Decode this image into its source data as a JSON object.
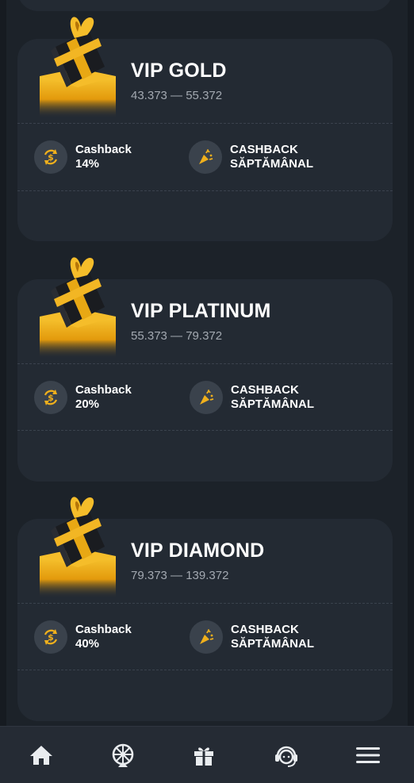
{
  "tiers": [
    {
      "title": "VIP GOLD",
      "range": "43.373 — 55.372",
      "cashback_label": "Cashback",
      "cashback_value": "14%",
      "weekly_line1": "CASHBACK",
      "weekly_line2": "SĂPTĂMÂNAL"
    },
    {
      "title": "VIP PLATINUM",
      "range": "55.373 — 79.372",
      "cashback_label": "Cashback",
      "cashback_value": "20%",
      "weekly_line1": "CASHBACK",
      "weekly_line2": "SĂPTĂMÂNAL"
    },
    {
      "title": "VIP DIAMOND",
      "range": "79.373 — 139.372",
      "cashback_label": "Cashback",
      "cashback_value": "40%",
      "weekly_line1": "CASHBACK",
      "weekly_line2": "SĂPTĂMÂNAL"
    }
  ],
  "icons": {
    "gift_image": "gift-box-icon",
    "cashback": "cashback-coin-icon",
    "weekly": "party-popper-icon"
  },
  "nav": {
    "items": [
      "home-icon",
      "wheel-of-fortune-icon",
      "gift-icon",
      "support-headset-icon",
      "menu-icon"
    ]
  },
  "colors": {
    "background": "#1c2229",
    "card": "#232a33",
    "accent_gold": "#f0b01c",
    "icon_circle": "#3a424c",
    "muted_text": "#a3a9b1"
  }
}
